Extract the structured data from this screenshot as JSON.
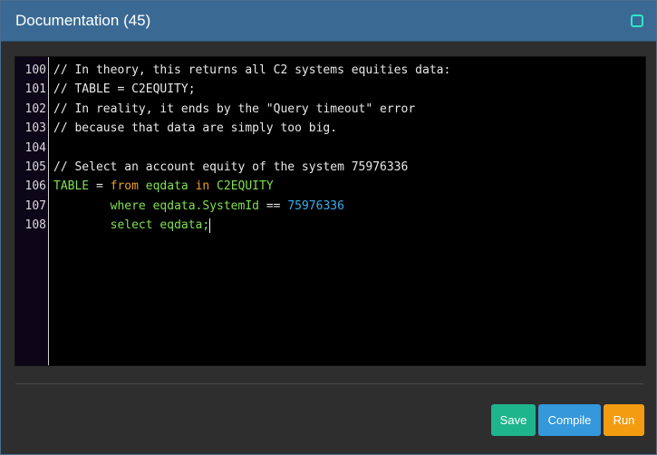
{
  "window": {
    "title": "Documentation (45)",
    "restore_icon": "restore-icon",
    "accent_color": "#3a6a93"
  },
  "editor": {
    "lines": [
      {
        "number": "100",
        "tokens": [
          {
            "type": "comment",
            "text": "// In theory, this returns all C2 systems equities data:"
          }
        ]
      },
      {
        "number": "101",
        "tokens": [
          {
            "type": "comment",
            "text": "// TABLE = C2EQUITY;"
          }
        ]
      },
      {
        "number": "102",
        "tokens": [
          {
            "type": "comment",
            "text": "// In reality, it ends by the \"Query timeout\" error"
          }
        ]
      },
      {
        "number": "103",
        "tokens": [
          {
            "type": "comment",
            "text": "// because that data are simply too big."
          }
        ]
      },
      {
        "number": "104",
        "tokens": []
      },
      {
        "number": "105",
        "tokens": [
          {
            "type": "comment",
            "text": "// Select an account equity of the system 75976336"
          }
        ]
      },
      {
        "number": "106",
        "tokens": [
          {
            "type": "ident",
            "text": "TABLE"
          },
          {
            "type": "op",
            "text": " = "
          },
          {
            "type": "kw",
            "text": "from"
          },
          {
            "type": "op",
            "text": " "
          },
          {
            "type": "ident",
            "text": "eqdata"
          },
          {
            "type": "op",
            "text": " "
          },
          {
            "type": "kw",
            "text": "in"
          },
          {
            "type": "op",
            "text": " "
          },
          {
            "type": "ident",
            "text": "C2EQUITY"
          }
        ]
      },
      {
        "number": "107",
        "tokens": [
          {
            "type": "op",
            "text": "        "
          },
          {
            "type": "ident",
            "text": "where eqdata.SystemId"
          },
          {
            "type": "op",
            "text": " == "
          },
          {
            "type": "num",
            "text": "75976336"
          }
        ]
      },
      {
        "number": "108",
        "tokens": [
          {
            "type": "op",
            "text": "        "
          },
          {
            "type": "ident",
            "text": "select eqdata;"
          }
        ]
      }
    ],
    "cursor_line": "108"
  },
  "buttons": {
    "save_label": "Save",
    "compile_label": "Compile",
    "run_label": "Run",
    "save_color": "#1fb58c",
    "compile_color": "#3498db",
    "run_color": "#f39c12"
  }
}
